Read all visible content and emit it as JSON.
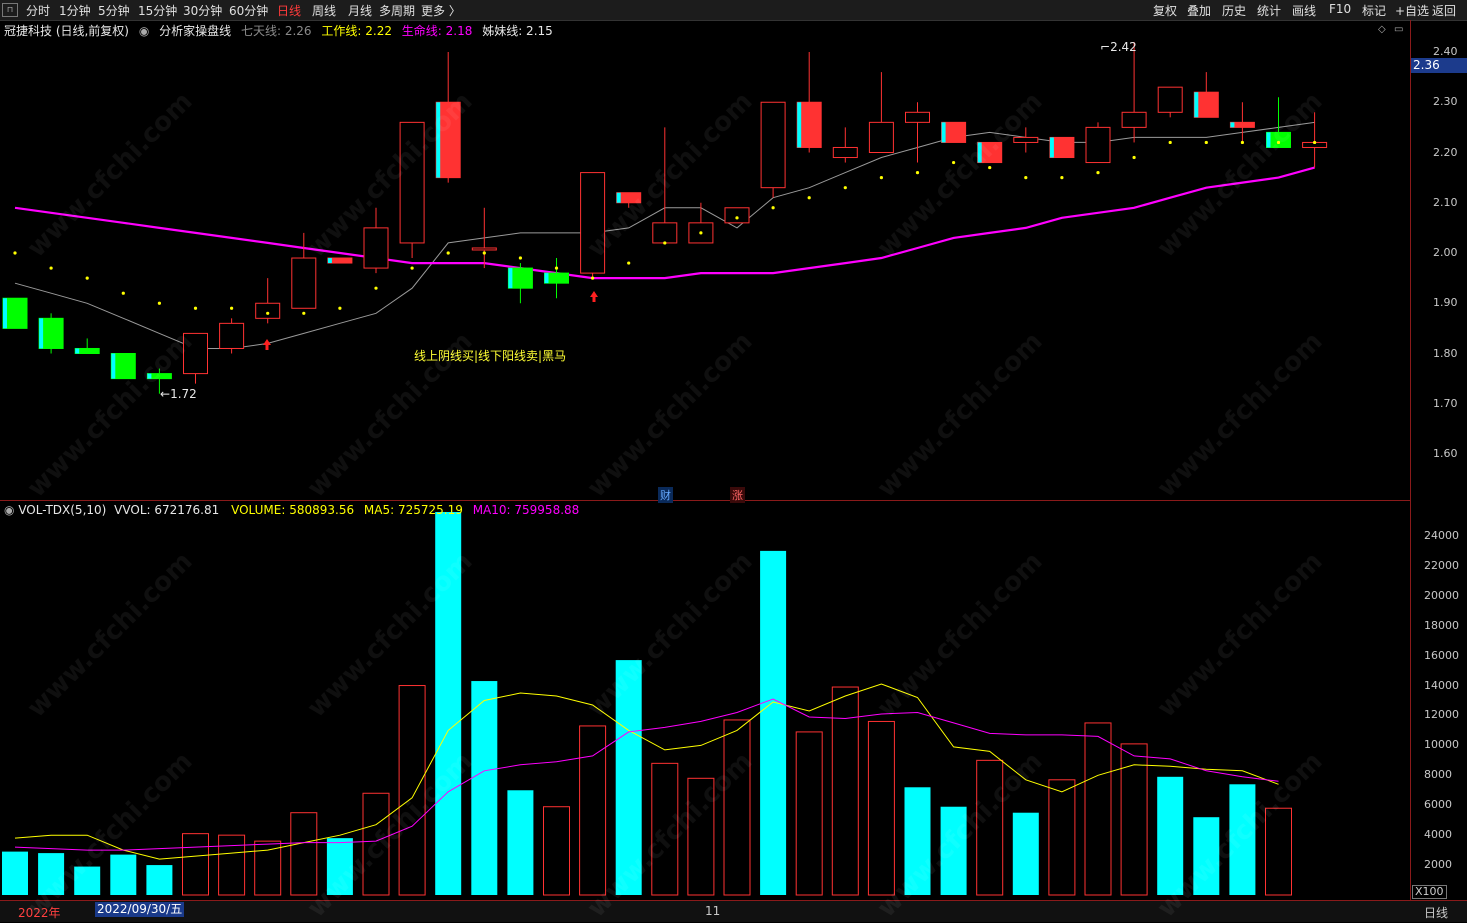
{
  "toolbar": {
    "left_items": [
      {
        "label": "分时"
      },
      {
        "label": "1分钟"
      },
      {
        "label": "5分钟"
      },
      {
        "label": "15分钟"
      },
      {
        "label": "30分钟"
      },
      {
        "label": "60分钟"
      },
      {
        "label": "日线",
        "active": true
      },
      {
        "label": "周线"
      },
      {
        "label": "月线"
      },
      {
        "label": "多周期"
      },
      {
        "label": "更多 〉"
      }
    ],
    "right_items": [
      {
        "label": "复权"
      },
      {
        "label": "叠加"
      },
      {
        "label": "历史"
      },
      {
        "label": "统计"
      },
      {
        "label": "画线"
      },
      {
        "label": "F10"
      },
      {
        "label": "标记"
      },
      {
        "label": "+自选"
      },
      {
        "label": "返回"
      }
    ]
  },
  "info": {
    "stock": "冠捷科技 (日线,前复权)",
    "indicator": "分析家操盘线",
    "qitian": "七天线: 2.26",
    "gongzuo": "工作线: 2.22",
    "shengming": "生命线: 2.18",
    "zimei": "姊妹线: 2.15"
  },
  "price_tag": "2.36",
  "annotations": {
    "high": "2.42",
    "low": "1.72",
    "signal_text": "线上阴线买|线下阳线卖|黑马",
    "chip_cai": "财",
    "chip_zhang": "涨"
  },
  "volume_info": {
    "title": "VOL-TDX(5,10)",
    "vvol": "VVOL: 672176.81",
    "volume": "VOLUME: 580893.56",
    "ma5": "MA5: 725725.19",
    "ma10": "MA10: 759958.88"
  },
  "price_axis": [
    "2.40",
    "2.30",
    "2.20",
    "2.10",
    "2.00",
    "1.90",
    "1.80",
    "1.70",
    "1.60"
  ],
  "volume_axis": [
    "24000",
    "22000",
    "20000",
    "18000",
    "16000",
    "14000",
    "12000",
    "10000",
    "8000",
    "6000",
    "4000",
    "2000"
  ],
  "x100": "X100",
  "bottom": {
    "year": "2022年",
    "date": "2022/09/30/五",
    "month": "11",
    "period": "日线"
  },
  "watermark": "www.cfchi.com",
  "colors": {
    "up": "#ff3232",
    "down_fill": "#00ffff",
    "green": "#00ff00",
    "magenta": "#ff00ff",
    "yellow": "#ffff00",
    "grey": "#c8c8c8"
  },
  "chart_data": {
    "type": "candlestick",
    "price_ylim": [
      1.55,
      2.45
    ],
    "candles": [
      {
        "o": 1.91,
        "h": 1.91,
        "l": 1.85,
        "c": 1.85,
        "color": "green"
      },
      {
        "o": 1.87,
        "h": 1.88,
        "l": 1.8,
        "c": 1.81,
        "color": "green"
      },
      {
        "o": 1.81,
        "h": 1.83,
        "l": 1.8,
        "c": 1.8,
        "color": "green"
      },
      {
        "o": 1.8,
        "h": 1.8,
        "l": 1.75,
        "c": 1.75,
        "color": "green"
      },
      {
        "o": 1.76,
        "h": 1.77,
        "l": 1.72,
        "c": 1.75,
        "color": "green"
      },
      {
        "o": 1.76,
        "h": 1.84,
        "l": 1.74,
        "c": 1.84,
        "color": "up"
      },
      {
        "o": 1.81,
        "h": 1.87,
        "l": 1.8,
        "c": 1.86,
        "color": "up"
      },
      {
        "o": 1.87,
        "h": 1.95,
        "l": 1.86,
        "c": 1.9,
        "color": "up"
      },
      {
        "o": 1.89,
        "h": 2.04,
        "l": 1.89,
        "c": 1.99,
        "color": "up"
      },
      {
        "o": 1.99,
        "h": 1.99,
        "l": 1.98,
        "c": 1.98,
        "color": "red"
      },
      {
        "o": 1.97,
        "h": 2.09,
        "l": 1.96,
        "c": 2.05,
        "color": "up"
      },
      {
        "o": 2.02,
        "h": 2.26,
        "l": 1.99,
        "c": 2.26,
        "color": "up"
      },
      {
        "o": 2.3,
        "h": 2.4,
        "l": 2.14,
        "c": 2.15,
        "color": "red"
      },
      {
        "o": 2.01,
        "h": 2.09,
        "l": 1.97,
        "c": 2.01,
        "color": "up"
      },
      {
        "o": 1.97,
        "h": 1.98,
        "l": 1.9,
        "c": 1.93,
        "color": "green"
      },
      {
        "o": 1.96,
        "h": 1.99,
        "l": 1.91,
        "c": 1.94,
        "color": "green"
      },
      {
        "o": 1.96,
        "h": 2.16,
        "l": 1.95,
        "c": 2.16,
        "color": "up"
      },
      {
        "o": 2.12,
        "h": 2.12,
        "l": 2.09,
        "c": 2.1,
        "color": "red"
      },
      {
        "o": 2.02,
        "h": 2.25,
        "l": 2.02,
        "c": 2.06,
        "color": "up"
      },
      {
        "o": 2.02,
        "h": 2.1,
        "l": 2.02,
        "c": 2.06,
        "color": "up"
      },
      {
        "o": 2.06,
        "h": 2.09,
        "l": 2.06,
        "c": 2.09,
        "color": "up"
      },
      {
        "o": 2.13,
        "h": 2.3,
        "l": 2.11,
        "c": 2.3,
        "color": "up"
      },
      {
        "o": 2.3,
        "h": 2.4,
        "l": 2.2,
        "c": 2.21,
        "color": "red"
      },
      {
        "o": 2.19,
        "h": 2.25,
        "l": 2.18,
        "c": 2.21,
        "color": "up"
      },
      {
        "o": 2.2,
        "h": 2.36,
        "l": 2.2,
        "c": 2.26,
        "color": "up"
      },
      {
        "o": 2.26,
        "h": 2.3,
        "l": 2.18,
        "c": 2.28,
        "color": "up"
      },
      {
        "o": 2.26,
        "h": 2.26,
        "l": 2.22,
        "c": 2.22,
        "color": "red"
      },
      {
        "o": 2.22,
        "h": 2.22,
        "l": 2.18,
        "c": 2.18,
        "color": "red"
      },
      {
        "o": 2.22,
        "h": 2.25,
        "l": 2.2,
        "c": 2.23,
        "color": "up"
      },
      {
        "o": 2.23,
        "h": 2.23,
        "l": 2.19,
        "c": 2.19,
        "color": "red"
      },
      {
        "o": 2.18,
        "h": 2.26,
        "l": 2.18,
        "c": 2.25,
        "color": "up"
      },
      {
        "o": 2.25,
        "h": 2.42,
        "l": 2.22,
        "c": 2.28,
        "color": "up"
      },
      {
        "o": 2.28,
        "h": 2.33,
        "l": 2.27,
        "c": 2.33,
        "color": "up"
      },
      {
        "o": 2.32,
        "h": 2.36,
        "l": 2.27,
        "c": 2.27,
        "color": "red"
      },
      {
        "o": 2.26,
        "h": 2.3,
        "l": 2.22,
        "c": 2.25,
        "color": "red"
      },
      {
        "o": 2.24,
        "h": 2.31,
        "l": 2.21,
        "c": 2.21,
        "color": "green"
      },
      {
        "o": 2.22,
        "h": 2.28,
        "l": 2.17,
        "c": 2.21,
        "color": "up"
      }
    ],
    "qitian_line": [
      1.94,
      1.92,
      1.9,
      1.87,
      1.84,
      1.81,
      1.81,
      1.82,
      1.84,
      1.86,
      1.88,
      1.93,
      2.02,
      2.03,
      2.04,
      2.04,
      2.04,
      2.05,
      2.09,
      2.09,
      2.05,
      2.11,
      2.13,
      2.16,
      2.19,
      2.21,
      2.23,
      2.24,
      2.23,
      2.22,
      2.22,
      2.23,
      2.23,
      2.23,
      2.24,
      2.25,
      2.26
    ],
    "shengming_line": [
      2.09,
      2.08,
      2.07,
      2.06,
      2.05,
      2.04,
      2.03,
      2.02,
      2.01,
      2.0,
      1.99,
      1.98,
      1.98,
      1.98,
      1.97,
      1.96,
      1.95,
      1.95,
      1.95,
      1.96,
      1.96,
      1.96,
      1.97,
      1.98,
      1.99,
      2.01,
      2.03,
      2.04,
      2.05,
      2.07,
      2.08,
      2.09,
      2.11,
      2.13,
      2.14,
      2.15,
      2.17
    ],
    "dots": [
      2.0,
      1.97,
      1.95,
      1.92,
      1.9,
      1.89,
      1.89,
      1.88,
      1.88,
      1.89,
      1.93,
      1.97,
      2.0,
      2.0,
      1.99,
      1.97,
      1.95,
      1.98,
      2.02,
      2.04,
      2.07,
      2.09,
      2.11,
      2.13,
      2.15,
      2.16,
      2.18,
      2.17,
      2.15,
      2.15,
      2.16,
      2.19,
      2.22,
      2.22,
      2.22,
      2.22,
      2.22
    ],
    "volume": [
      2900,
      2800,
      1900,
      2700,
      2000,
      4100,
      4000,
      3600,
      5500,
      3800,
      6800,
      14000,
      25600,
      14300,
      7000,
      5900,
      11300,
      15700,
      8800,
      7800,
      11700,
      23000,
      10900,
      13900,
      11600,
      7200,
      5900,
      9000,
      5500,
      7700,
      11500,
      10100,
      7900,
      5200,
      7400,
      5800
    ],
    "volume_kind": [
      "cyan",
      "cyan",
      "cyan",
      "cyan",
      "cyan",
      "up",
      "up",
      "up",
      "up",
      "cyan",
      "up",
      "up",
      "cyan",
      "cyan",
      "cyan",
      "up",
      "up",
      "cyan",
      "up",
      "up",
      "up",
      "cyan",
      "up",
      "up",
      "up",
      "cyan",
      "cyan",
      "up",
      "cyan",
      "up",
      "up",
      "up",
      "cyan",
      "cyan",
      "cyan",
      "up"
    ],
    "volume_ma5": [
      3800,
      4000,
      4000,
      3000,
      2400,
      2600,
      2800,
      3000,
      3500,
      4000,
      4700,
      6500,
      11000,
      13000,
      13500,
      13300,
      12700,
      11000,
      9700,
      10000,
      11000,
      12900,
      12300,
      13300,
      14100,
      13200,
      9900,
      9600,
      7700,
      6900,
      8000,
      8700,
      8600,
      8400,
      8300,
      7400
    ],
    "volume_ma10": [
      3200,
      3100,
      3000,
      3000,
      3100,
      3200,
      3300,
      3400,
      3500,
      3500,
      3600,
      4600,
      6900,
      8300,
      8700,
      8900,
      9300,
      10900,
      11200,
      11600,
      12200,
      13100,
      11900,
      11800,
      12100,
      12200,
      11500,
      10800,
      10700,
      10700,
      10600,
      9300,
      9100,
      8300,
      7900,
      7600
    ],
    "volume_ylim": [
      0,
      26000
    ]
  }
}
